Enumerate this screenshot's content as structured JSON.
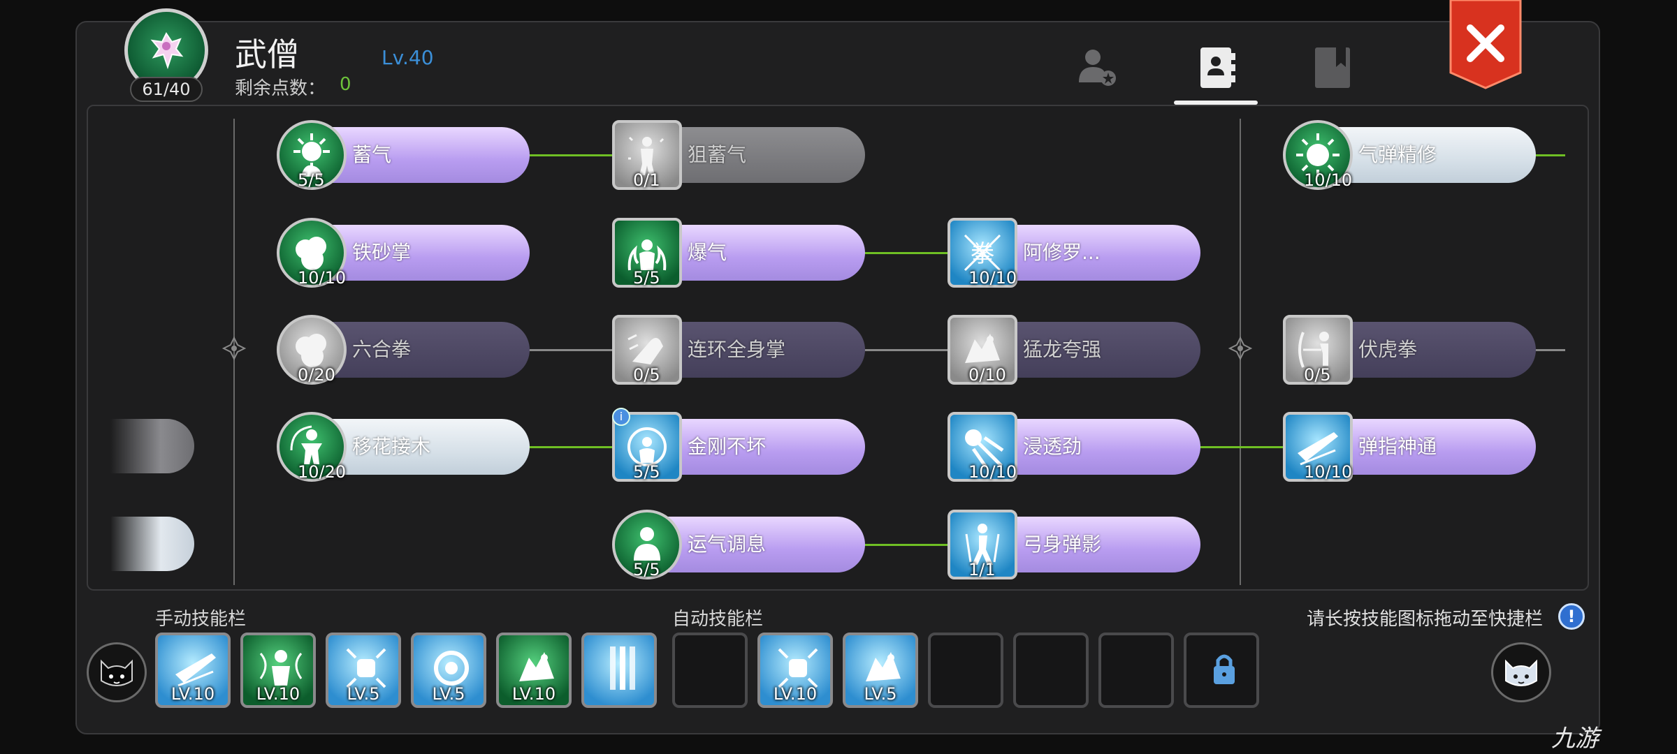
{
  "header": {
    "character_name": "武僧",
    "level": "Lv.40",
    "points_label": "剩余点数：",
    "points_value": "0",
    "avatar_count": "61/40",
    "tabs": [
      {
        "icon": "character-info-icon",
        "active": false
      },
      {
        "icon": "skill-book-icon",
        "active": true
      },
      {
        "icon": "bookmark-book-icon",
        "active": false
      }
    ],
    "close_icon": "close-x-icon"
  },
  "skills": [
    {
      "name": "蓄气",
      "level": "5/5",
      "style": "purple",
      "icon_style": "green",
      "icon": "energy-burst-icon"
    },
    {
      "name": "狙蓄气",
      "level": "0/1",
      "style": "gray",
      "icon_style": "grey",
      "icon": "figure-sparkle-icon"
    },
    {
      "name": "气弹精修",
      "level": "10/10",
      "style": "light",
      "icon_style": "green",
      "icon": "energy-orb-icon"
    },
    {
      "name": "铁砂掌",
      "level": "10/10",
      "style": "purple",
      "icon_style": "green",
      "icon": "fist-cloud-icon"
    },
    {
      "name": "爆气",
      "level": "5/5",
      "style": "purple",
      "icon_style": "green",
      "icon": "flame-figure-icon"
    },
    {
      "name": "阿修罗...",
      "level": "10/10",
      "style": "purple",
      "icon_style": "blue",
      "icon": "asura-glyph-icon"
    },
    {
      "name": "六合拳",
      "level": "0/20",
      "style": "dim",
      "icon_style": "grey",
      "icon": "fist-cloud-icon"
    },
    {
      "name": "连环全身掌",
      "level": "0/5",
      "style": "dim",
      "icon_style": "grey",
      "icon": "palm-strike-icon"
    },
    {
      "name": "猛龙夸强",
      "level": "0/10",
      "style": "dim",
      "icon_style": "grey",
      "icon": "dragon-strike-icon"
    },
    {
      "name": "伏虎拳",
      "level": "0/5",
      "style": "dim",
      "icon_style": "grey",
      "icon": "bow-stance-icon"
    },
    {
      "name": "移花接木",
      "level": "10/20",
      "style": "light",
      "icon_style": "green",
      "icon": "spin-figure-icon"
    },
    {
      "name": "金刚不坏",
      "level": "5/5",
      "style": "purple",
      "icon_style": "blue",
      "icon": "shield-figure-icon",
      "info": "i"
    },
    {
      "name": "浸透劲",
      "level": "10/10",
      "style": "purple",
      "icon_style": "blue",
      "icon": "burst-palm-icon"
    },
    {
      "name": "弹指神通",
      "level": "10/10",
      "style": "purple",
      "icon_style": "blue",
      "icon": "flick-blade-icon"
    },
    {
      "name": "运气调息",
      "level": "5/5",
      "style": "purple",
      "icon_style": "green",
      "icon": "meditate-figure-icon"
    },
    {
      "name": "弓身弹影",
      "level": "1/1",
      "style": "purple",
      "icon_style": "blue",
      "icon": "leap-figure-icon"
    }
  ],
  "manual_bar": {
    "title": "手动技能栏",
    "slots": [
      {
        "level": "LV.10",
        "style": "blue",
        "icon": "flick-blade-icon"
      },
      {
        "level": "LV.10",
        "style": "green",
        "icon": "chain-figure-icon"
      },
      {
        "level": "LV.5",
        "style": "blue",
        "icon": "fist-burst-icon"
      },
      {
        "level": "LV.5",
        "style": "blue",
        "icon": "orb-swirl-icon"
      },
      {
        "level": "LV.10",
        "style": "green",
        "icon": "dragon-strike-icon"
      },
      {
        "level": "",
        "style": "blue",
        "icon": "light-pillar-icon"
      }
    ]
  },
  "auto_bar": {
    "title": "自动技能栏",
    "slots": [
      {
        "level": "",
        "style": "empty"
      },
      {
        "level": "LV.10",
        "style": "blue",
        "icon": "fist-burst-icon"
      },
      {
        "level": "LV.5",
        "style": "blue",
        "icon": "dragon-strike-icon"
      },
      {
        "level": "",
        "style": "empty"
      },
      {
        "level": "",
        "style": "empty"
      },
      {
        "level": "",
        "style": "empty"
      },
      {
        "level": "",
        "style": "locked",
        "icon": "lock-icon"
      }
    ]
  },
  "hint": {
    "text": "请长按技能图标拖动至快捷栏",
    "icon": "exclamation-info-icon"
  },
  "left_face_icon": "black-cat-face-icon",
  "right_face_icon": "white-cat-face-icon",
  "watermark": "九游",
  "colors": {
    "link_active": "#6fbf24",
    "link_inactive": "#8a8a8a",
    "level_text": "#3b8fd8",
    "points": "#6cc23a",
    "close": "#e2402a"
  }
}
